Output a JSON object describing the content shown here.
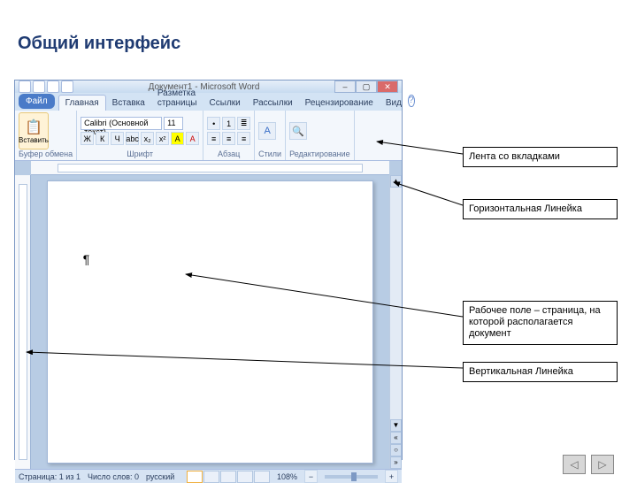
{
  "slide": {
    "title": "Общий интерфейс"
  },
  "window": {
    "title": "Документ1 - Microsoft Word",
    "min": "–",
    "max": "▢",
    "close": "✕"
  },
  "tabs": {
    "file": "Файл",
    "home": "Главная",
    "insert": "Вставка",
    "layout": "Разметка страницы",
    "references": "Ссылки",
    "mailings": "Рассылки",
    "review": "Рецензирование",
    "view": "Вид"
  },
  "ribbon": {
    "clipboard": {
      "paste": "Вставить",
      "group": "Буфер обмена"
    },
    "font": {
      "name": "Calibri (Основной текст)",
      "size": "11",
      "B": "Ж",
      "I": "К",
      "U": "Ч",
      "group": "Шрифт"
    },
    "paragraph": {
      "group": "Абзац"
    },
    "styles": {
      "label": "Стили"
    },
    "editing": {
      "label": "Редактирование"
    }
  },
  "page": {
    "pilcrow": "¶"
  },
  "status": {
    "page": "Страница: 1 из 1",
    "words": "Число слов: 0",
    "lang": "русский",
    "zoom": "108%"
  },
  "callouts": {
    "ribbon": "Лента со вкладками",
    "hruler": "Горизонтальная Линейка",
    "work": "Рабочее поле – страница, на которой располагается документ",
    "vruler": "Вертикальная Линейка"
  },
  "nav": {
    "prev": "◁",
    "next": "▷"
  }
}
